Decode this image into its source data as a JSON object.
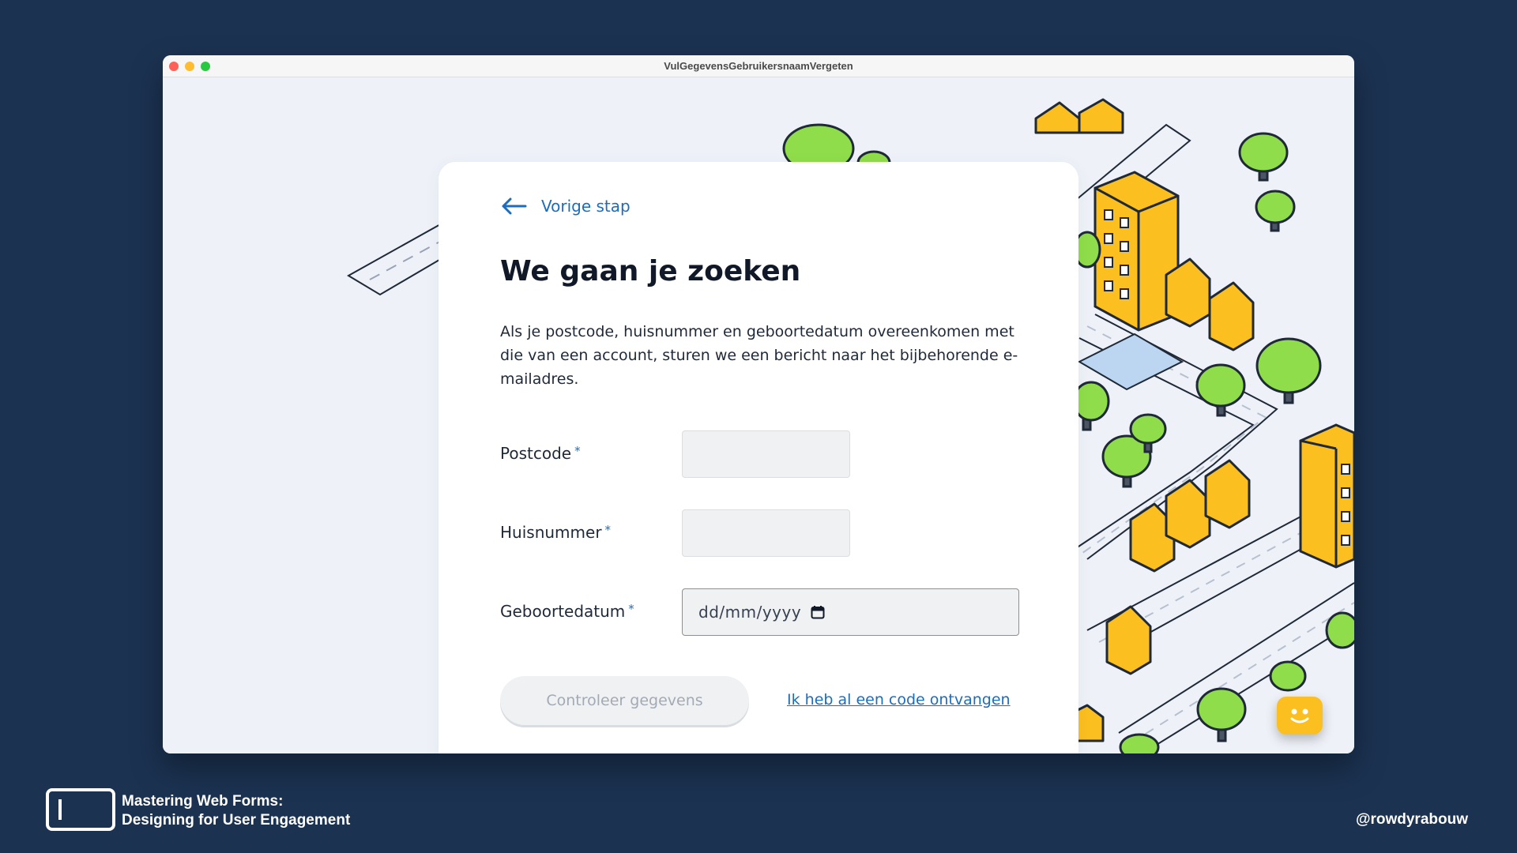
{
  "window": {
    "title": "VulGegevensGebruikersnaamVergeten"
  },
  "form": {
    "back_label": "Vorige stap",
    "title": "We gaan je zoeken",
    "description": "Als je postcode, huisnummer en geboortedatum overeenkomen met die van een account, sturen we een bericht naar het bijbehorende e-mailadres.",
    "fields": [
      {
        "label": "Postcode",
        "required_mark": "*",
        "value": ""
      },
      {
        "label": "Huisnummer",
        "required_mark": "*",
        "value": ""
      },
      {
        "label": "Geboortedatum",
        "required_mark": "*",
        "placeholder": "dd/mm/yyyy"
      }
    ],
    "submit_label": "Controleer gegevens",
    "code_link": "Ik heb al een code ontvangen"
  },
  "footer": {
    "title_line1": "Mastering Web Forms:",
    "title_line2": "Designing for User Engagement",
    "handle": "@rowdyrabouw"
  },
  "colors": {
    "background": "#1b3251",
    "accent": "#1d6dbb",
    "building": "#fbbf1f",
    "tree": "#8fdd4a"
  },
  "icons": [
    "arrow-left-icon",
    "calendar-icon",
    "chat-bot-icon",
    "presentation-logo-icon"
  ]
}
